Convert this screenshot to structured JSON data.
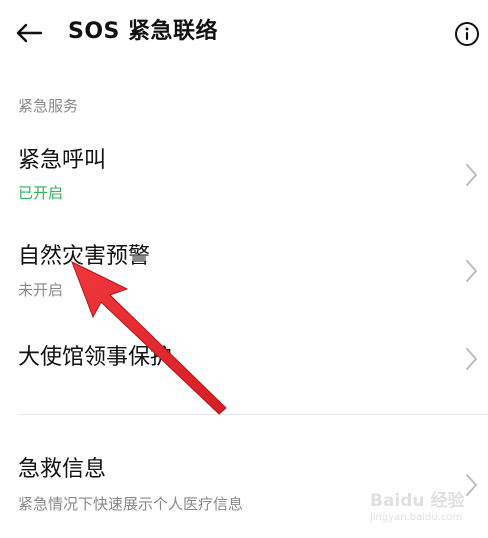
{
  "header": {
    "back_icon": "arrow-left-icon",
    "title": "SOS 紧急联络",
    "info_icon": "info-circle-icon"
  },
  "section": {
    "label": "紧急服务"
  },
  "rows": [
    {
      "title": "紧急呼叫",
      "subtitle": "已开启",
      "subtitle_status": "on",
      "chevron_icon": "chevron-right-icon"
    },
    {
      "title": "自然灾害预警",
      "subtitle": "未开启",
      "subtitle_status": "off",
      "chevron_icon": "chevron-right-icon"
    },
    {
      "title": "大使馆领事保护",
      "chevron_icon": "chevron-right-icon"
    },
    {
      "title": "急救信息",
      "subtitle": "紧急情况下快速展示个人医疗信息",
      "chevron_icon": "chevron-right-icon"
    }
  ],
  "annotation": {
    "arrow_icon": "red-pointer-arrow-icon",
    "color": "#e8262d"
  },
  "watermark": {
    "logo": "Baidu 经验",
    "url": "jingyan.baidu.com"
  },
  "colors": {
    "enabled_green": "#2cb35c",
    "secondary_gray": "#8a8a8a",
    "divider": "#e6e6e6"
  }
}
